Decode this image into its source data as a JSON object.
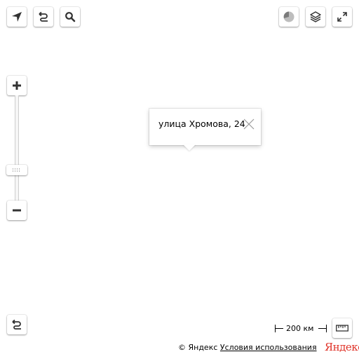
{
  "map": {
    "balloon": {
      "address": "улица Хромова, 24"
    },
    "scale": {
      "label": "200 км"
    },
    "copyright": {
      "owner": "© Яндекс",
      "terms_link": "Условия использования"
    },
    "logo": {
      "text": "Яндекс"
    }
  },
  "controls": {
    "top_left": [
      "geolocation-icon",
      "route-icon",
      "search-icon"
    ],
    "top_right": [
      "traffic-icon",
      "layers-icon",
      "fullscreen-icon"
    ],
    "bottom_left": [
      "route-icon"
    ],
    "bottom_right": [
      "ruler-icon"
    ],
    "zoom": [
      "plus-icon",
      "minus-icon"
    ]
  },
  "colors": {
    "logo": "#e0352b",
    "icon": "#333333",
    "background": "#ffffff"
  }
}
